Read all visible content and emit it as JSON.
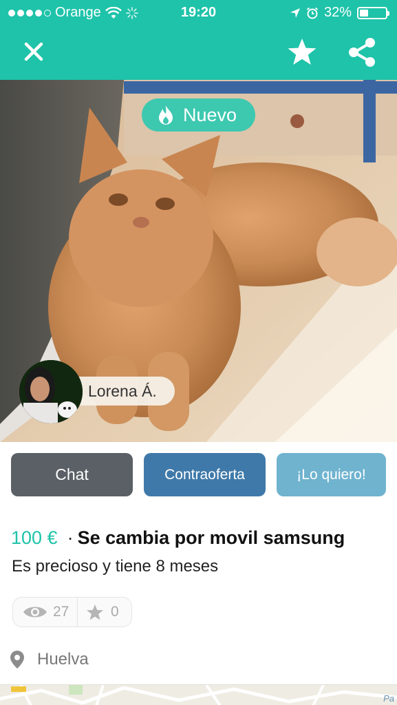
{
  "status_bar": {
    "carrier": "Orange",
    "time": "19:20",
    "battery": "32%",
    "battery_level": 0.32,
    "signal_bars": 4
  },
  "nav": {
    "close_icon": "close-icon",
    "favorite_icon": "star-icon",
    "share_icon": "share-icon"
  },
  "listing": {
    "badge": "Nuevo",
    "seller_name": "Lorena Á.",
    "price": "100 €",
    "separator": "·",
    "title": "Se cambia por movil samsung",
    "description": "Es precioso y tiene 8 meses",
    "views": "27",
    "favorites": "0",
    "location": "Huelva"
  },
  "actions": {
    "chat": "Chat",
    "counteroffer": "Contraoferta",
    "want": "¡Lo quiero!"
  },
  "map": {
    "label": "Pa"
  },
  "colors": {
    "brand": "#1ec3a9",
    "chat_button": "#5a6065",
    "counteroffer_button": "#3f79a9",
    "want_button": "#6fb3cf"
  }
}
